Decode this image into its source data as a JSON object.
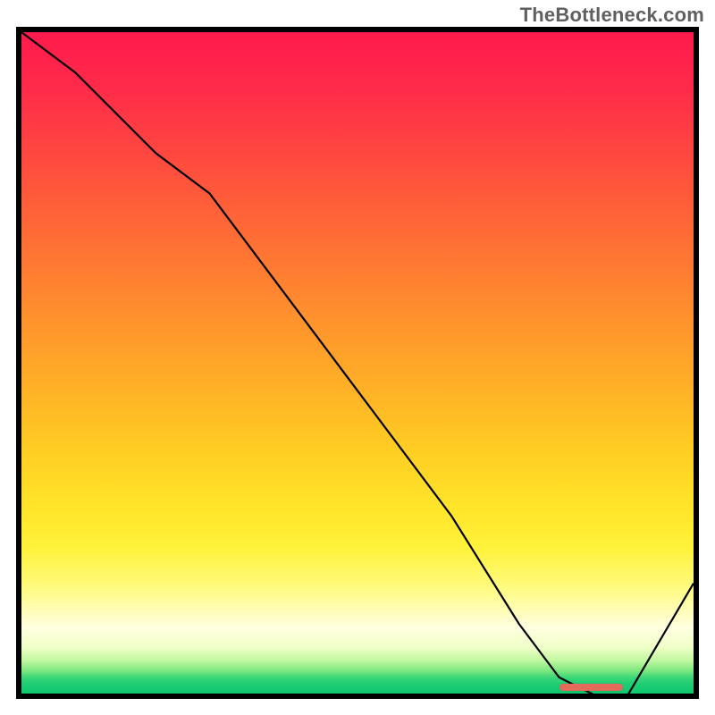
{
  "watermark": "TheBottleneck.com",
  "chart_data": {
    "type": "line",
    "title": "",
    "xlabel": "",
    "ylabel": "",
    "xlim": [
      0,
      100
    ],
    "ylim": [
      0,
      100
    ],
    "grid": false,
    "legend": false,
    "series": [
      {
        "name": "bottleneck-curve",
        "x": [
          0,
          8,
          20,
          28,
          40,
          52,
          64,
          74,
          80,
          86,
          90,
          100
        ],
        "values": [
          100,
          94,
          82,
          76,
          60,
          44,
          28,
          12,
          4,
          1,
          1,
          18
        ]
      }
    ],
    "marker": {
      "name": "optimal-range",
      "x_start": 80,
      "x_end": 89.5,
      "y": 1
    },
    "colors": {
      "curve": "#000000",
      "marker": "#e46a5c",
      "gradient_top": "#ff1a4d",
      "gradient_mid": "#ffd023",
      "gradient_bottom": "#0ec86f"
    }
  }
}
